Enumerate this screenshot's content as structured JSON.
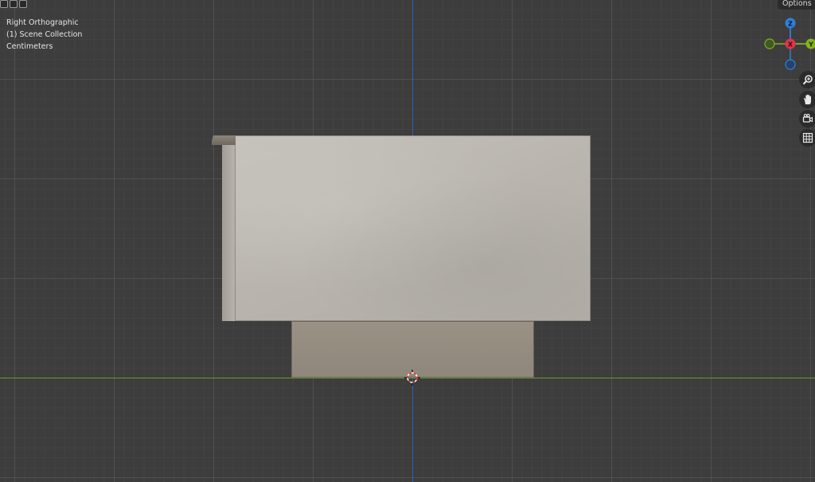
{
  "header": {
    "options_label": "Options"
  },
  "viewport_info": {
    "view_name": "Right Orthographic",
    "collection": "(1) Scene Collection",
    "units": "Centimeters"
  },
  "gizmo": {
    "z_label": "Z",
    "x_label": "X",
    "y_label": "Y",
    "colors": {
      "z": "#2f7fdc",
      "x": "#e1344b",
      "y": "#83b21e"
    }
  },
  "axis_colors": {
    "vertical": "#2f61b5",
    "horizontal": "#6a9a2a"
  },
  "nav_tools": [
    {
      "name": "zoom-icon"
    },
    {
      "name": "pan-hand-icon"
    },
    {
      "name": "camera-icon"
    },
    {
      "name": "ortho-grid-icon"
    }
  ]
}
